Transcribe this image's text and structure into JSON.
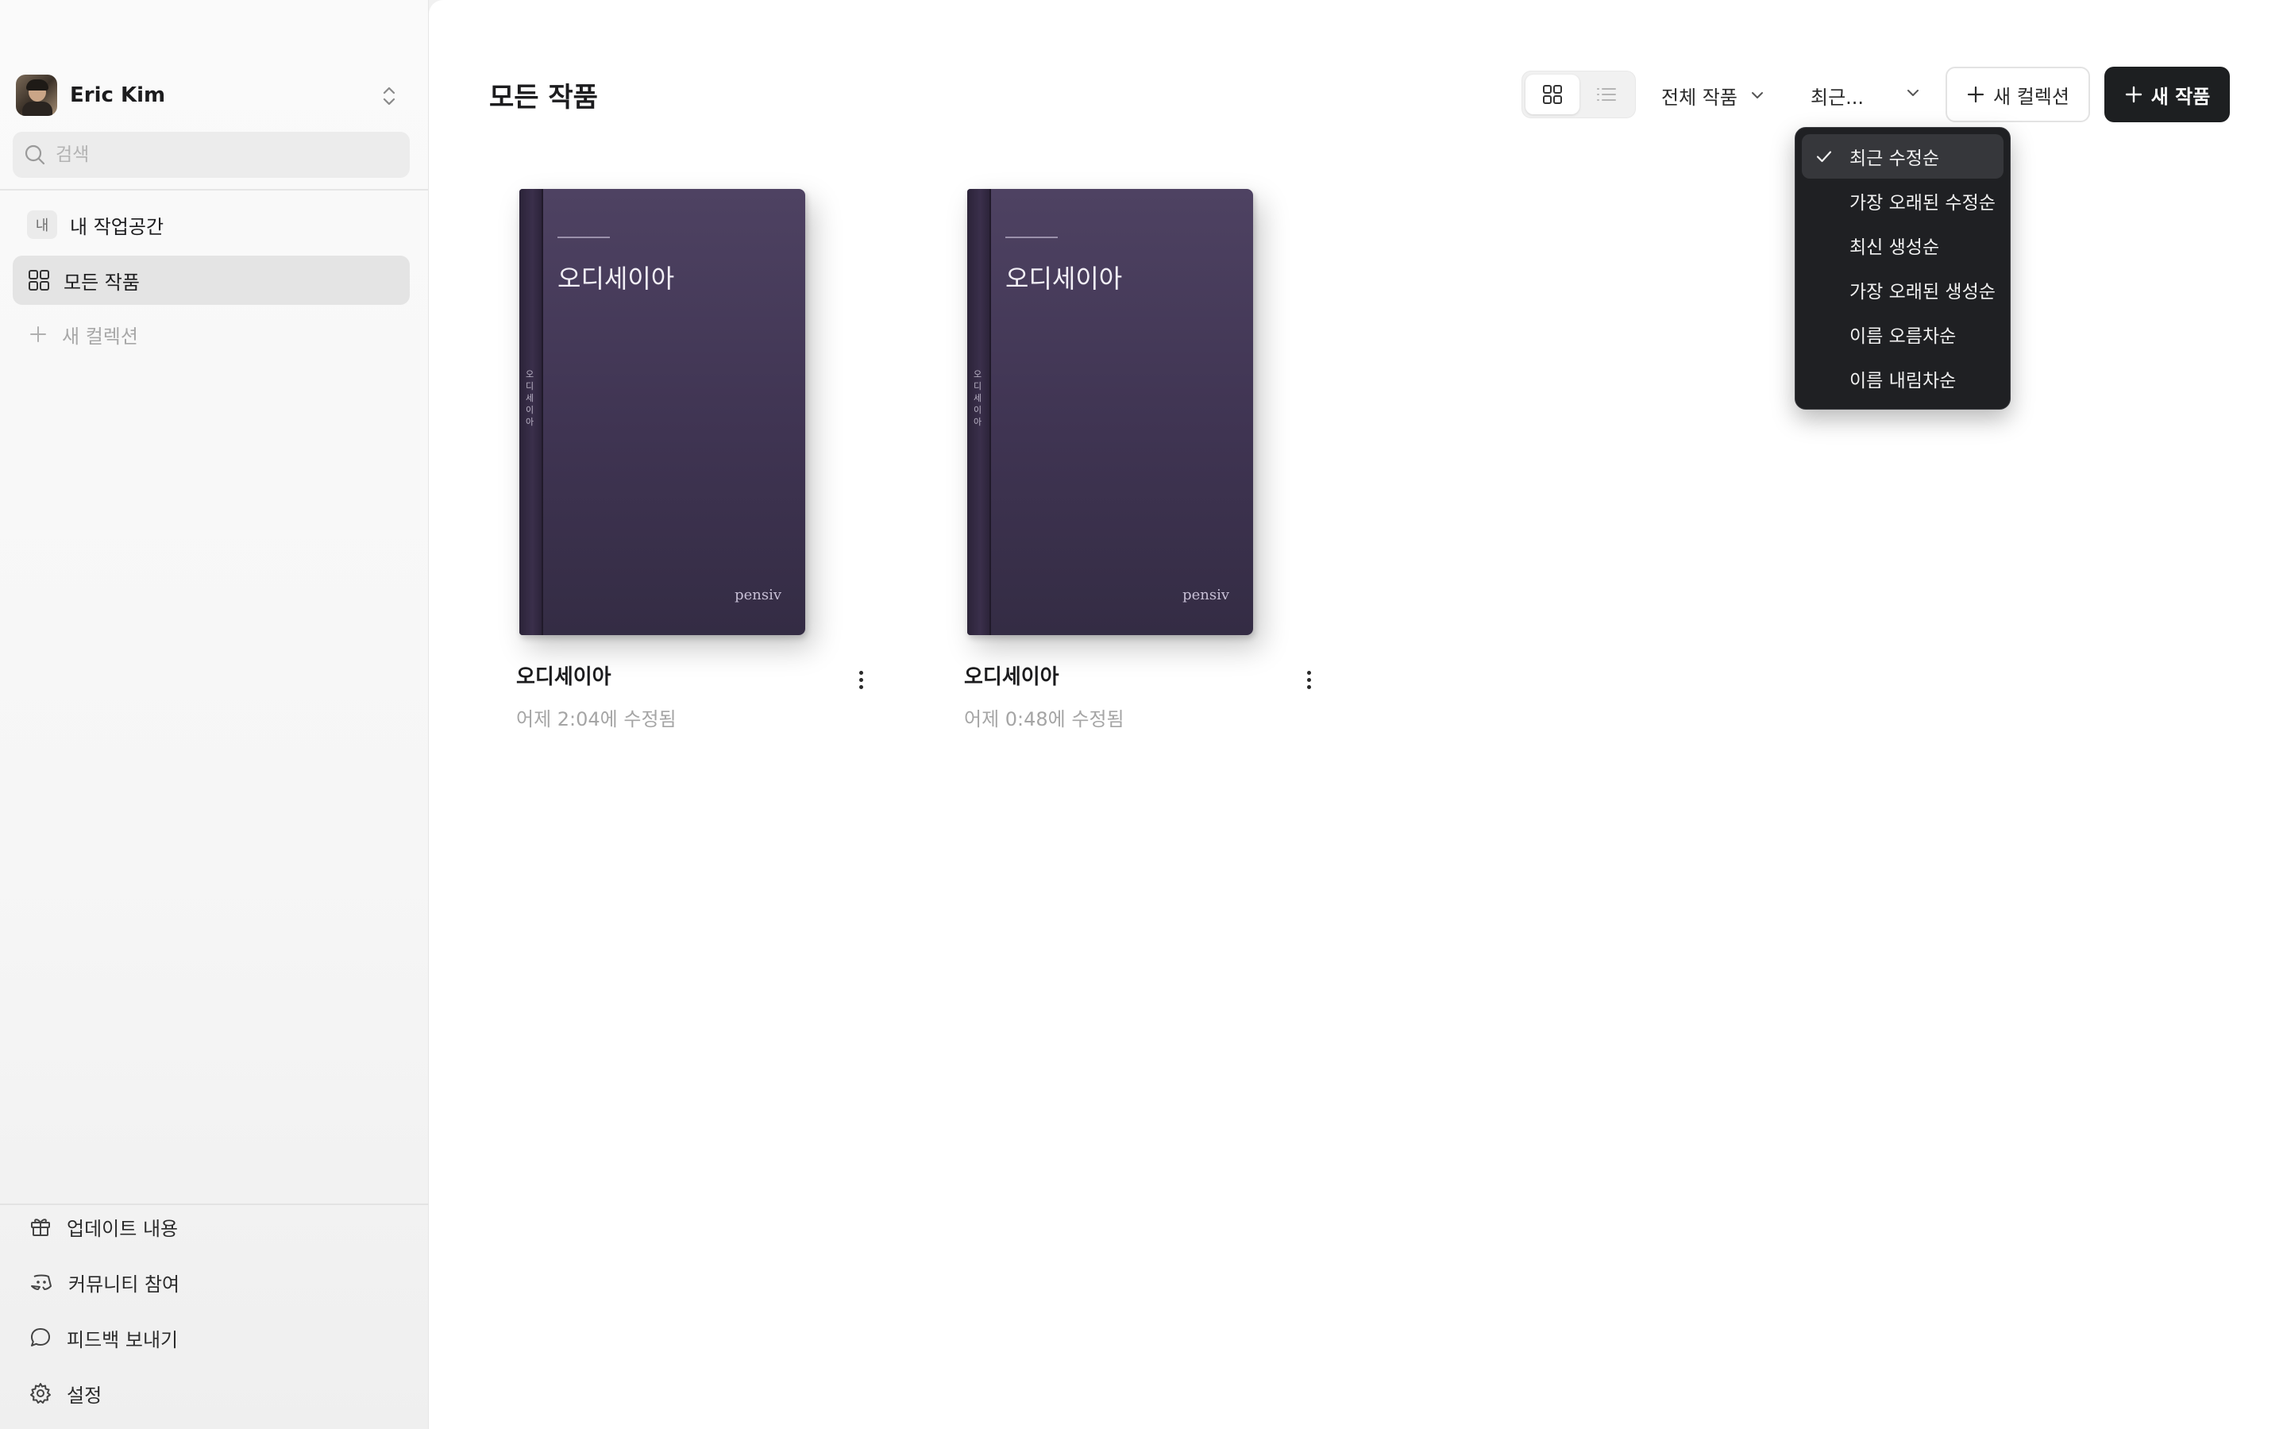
{
  "sidebar": {
    "profile_name": "Eric Kim",
    "search_placeholder": "검색",
    "workspace_badge": "내",
    "workspace_label": "내 작업공간",
    "all_works_label": "모든 작품",
    "new_collection_label": "새 컬렉션",
    "footer": {
      "updates_label": "업데이트 내용",
      "community_label": "커뮤니티 참여",
      "feedback_label": "피드백 보내기",
      "settings_label": "설정"
    }
  },
  "main": {
    "title": "모든 작품",
    "filter_label": "전체 작품",
    "sort_label": "최근...",
    "new_collection_button": "새 컬렉션",
    "new_work_button": "새 작품",
    "view_mode": "grid"
  },
  "books": [
    {
      "title": "오디세이아",
      "cover_title": "오디세이아",
      "brand": "pensiv",
      "spine_text": "오디세이아",
      "meta": "어제 2:04에 수정됨"
    },
    {
      "title": "오디세이아",
      "cover_title": "오디세이아",
      "brand": "pensiv",
      "spine_text": "오디세이아",
      "meta": "어제 0:48에 수정됨"
    }
  ],
  "sort_menu": {
    "selected_index": 0,
    "items": [
      "최근 수정순",
      "가장 오래된 수정순",
      "최신 생성순",
      "가장 오래된 생성순",
      "이름 오름차순",
      "이름 내림차순"
    ]
  },
  "colors": {
    "book_cover": "#4a3e5e",
    "primary_button": "#1d1f21",
    "menu_bg": "#1f2023"
  }
}
